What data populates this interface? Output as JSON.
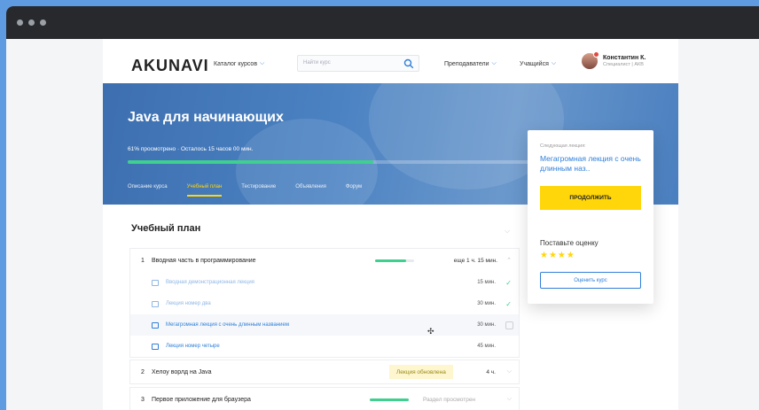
{
  "window": {
    "title_dots": 3
  },
  "navbar": {
    "logo": "AKUNAVI",
    "catalog": "Каталог курсов",
    "search_placeholder": "Найти курс",
    "teachers": "Преподаватели",
    "students": "Учащийся",
    "user_name": "Константин К.",
    "user_role": "Специалист | АКВ"
  },
  "hero": {
    "title": "Java для начинающих",
    "progress_text": "61% просмотрено · Осталось 15 часов 00 мин.",
    "progress_fraction": 0.61,
    "tabs": [
      {
        "label": "Описание курса",
        "active": false
      },
      {
        "label": "Учебный план",
        "active": true
      },
      {
        "label": "Тестирование",
        "active": false
      },
      {
        "label": "Объявления",
        "active": false
      },
      {
        "label": "Форум",
        "active": false
      }
    ]
  },
  "plan": {
    "title": "Учебный план",
    "sections": [
      {
        "num": "1",
        "title": "Вводная часть в программирование",
        "progress_fraction": 0.8,
        "time": "еще 1 ч. 15 мин.",
        "lessons": [
          {
            "title": "Вводная демонстрационная лекция",
            "time": "15 мин.",
            "done": true
          },
          {
            "title": "Лекция номер два",
            "time": "30 мин.",
            "done": true
          },
          {
            "title": "Мегагромная лекция с очень длинным названием",
            "time": "30 мин.",
            "done": false
          },
          {
            "title": "Лекция номер четыре",
            "time": "45 мин.",
            "done": false
          }
        ]
      },
      {
        "num": "2",
        "title": "Хелоу ворлд на Java",
        "badge": "Лекция обновлена",
        "time": "4 ч."
      },
      {
        "num": "3",
        "title": "Первое приложение для браузера",
        "progress_fraction": 1.0,
        "status": "Раздел просмотрен"
      }
    ]
  },
  "card": {
    "next_label": "Следующая лекция:",
    "next_title": "Мегагромная лекция с очень длинным наз..",
    "continue_label": "ПРОДОЛЖИТЬ",
    "rate_label": "Поставьте оценку",
    "stars": "★★★★",
    "rating": 4,
    "rate_button": "Оценить курс"
  },
  "colors": {
    "accent": "#2f7fd9",
    "yellow": "#ffd60a",
    "green": "#3fcf8e",
    "hero": "#4b82c2"
  }
}
